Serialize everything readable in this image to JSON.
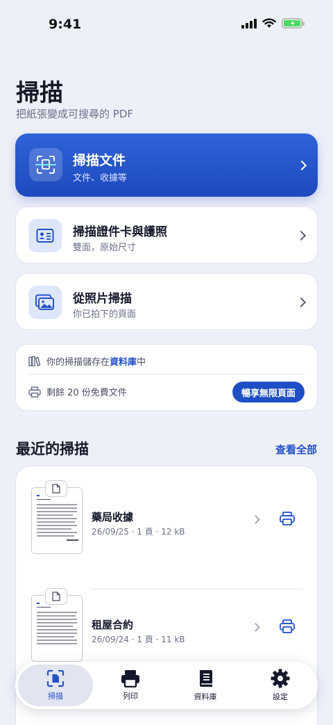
{
  "status_bar": {
    "time": "9:41"
  },
  "header": {
    "title": "掃描",
    "subtitle": "把紙張變成可搜尋的 PDF"
  },
  "scan_options": [
    {
      "title": "掃描文件",
      "subtitle": "文件、收據等",
      "icon": "scan-document-icon"
    },
    {
      "title": "掃描證件卡與護照",
      "subtitle": "雙面，原始尺寸",
      "icon": "id-card-icon"
    },
    {
      "title": "從照片掃描",
      "subtitle": "你已拍下的頁面",
      "icon": "photo-gallery-icon"
    }
  ],
  "info": {
    "storage_prefix": "你的掃描儲存在",
    "storage_link": "資料庫",
    "storage_suffix": "中",
    "remaining_text": "剩餘 20 份免費文件",
    "upgrade_label": "暢享無限頁面"
  },
  "recent": {
    "title": "最近的掃描",
    "view_all": "查看全部",
    "items": [
      {
        "name": "藥局收據",
        "meta": "26/09/25 · 1 頁 · 12 kB"
      },
      {
        "name": "租屋合約",
        "meta": "26/09/24 · 1 頁 · 11 kB"
      }
    ]
  },
  "tabs": [
    {
      "label": "掃描",
      "icon": "scan-tab-icon",
      "active": true
    },
    {
      "label": "列印",
      "icon": "printer-icon",
      "active": false
    },
    {
      "label": "資料庫",
      "icon": "library-icon",
      "active": false
    },
    {
      "label": "設定",
      "icon": "gear-icon",
      "active": false
    }
  ],
  "colors": {
    "accent": "#2452c8",
    "primary_card": "#2557cf",
    "background": "#eef0f9"
  }
}
